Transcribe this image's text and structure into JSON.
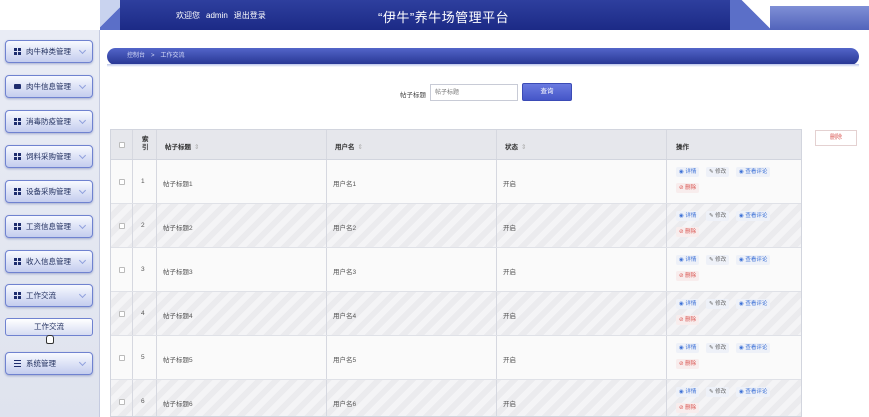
{
  "header": {
    "welcome": "欢迎您",
    "user": "admin",
    "logout": "退出登录",
    "title": "“伊牛”养牛场管理平台"
  },
  "sidebar": {
    "items": [
      {
        "label": "肉牛种类管理",
        "icon": "grid-icon"
      },
      {
        "label": "肉牛信息管理",
        "icon": "monitor-icon"
      },
      {
        "label": "消毒防疫管理",
        "icon": "grid-icon"
      },
      {
        "label": "饲料采购管理",
        "icon": "grid-icon"
      },
      {
        "label": "设备采购管理",
        "icon": "grid-icon"
      },
      {
        "label": "工资信息管理",
        "icon": "grid-icon"
      },
      {
        "label": "收入信息管理",
        "icon": "grid-icon"
      },
      {
        "label": "工作交流",
        "icon": "grid-icon"
      }
    ],
    "sub_item": "工作交流",
    "last_item": {
      "label": "系统管理",
      "icon": "list-icon"
    }
  },
  "breadcrumb": {
    "home": "控制台",
    "sep": ">",
    "current": "工作交流"
  },
  "search": {
    "label": "帖子标题",
    "placeholder": "帖子标题",
    "button": "查询"
  },
  "toolbar": {
    "delete": "删除"
  },
  "table": {
    "headers": {
      "index": "索引",
      "title": "帖子标题",
      "user": "用户名",
      "status": "状态",
      "actions": "操作"
    },
    "actions": {
      "detail": "详情",
      "edit": "修改",
      "comments": "查看评论",
      "delete": "删除"
    },
    "rows": [
      {
        "index": "1",
        "title": "帖子标题1",
        "user": "用户名1",
        "status": "开启"
      },
      {
        "index": "2",
        "title": "帖子标题2",
        "user": "用户名2",
        "status": "开启"
      },
      {
        "index": "3",
        "title": "帖子标题3",
        "user": "用户名3",
        "status": "开启"
      },
      {
        "index": "4",
        "title": "帖子标题4",
        "user": "用户名4",
        "status": "开启"
      },
      {
        "index": "5",
        "title": "帖子标题5",
        "user": "用户名5",
        "status": "开启"
      },
      {
        "index": "6",
        "title": "帖子标题6",
        "user": "用户名6",
        "status": "开启"
      }
    ]
  },
  "colors": {
    "header_blue": "#1c2a86",
    "accent_blue": "#4556c8",
    "danger_red": "#d9534f"
  }
}
